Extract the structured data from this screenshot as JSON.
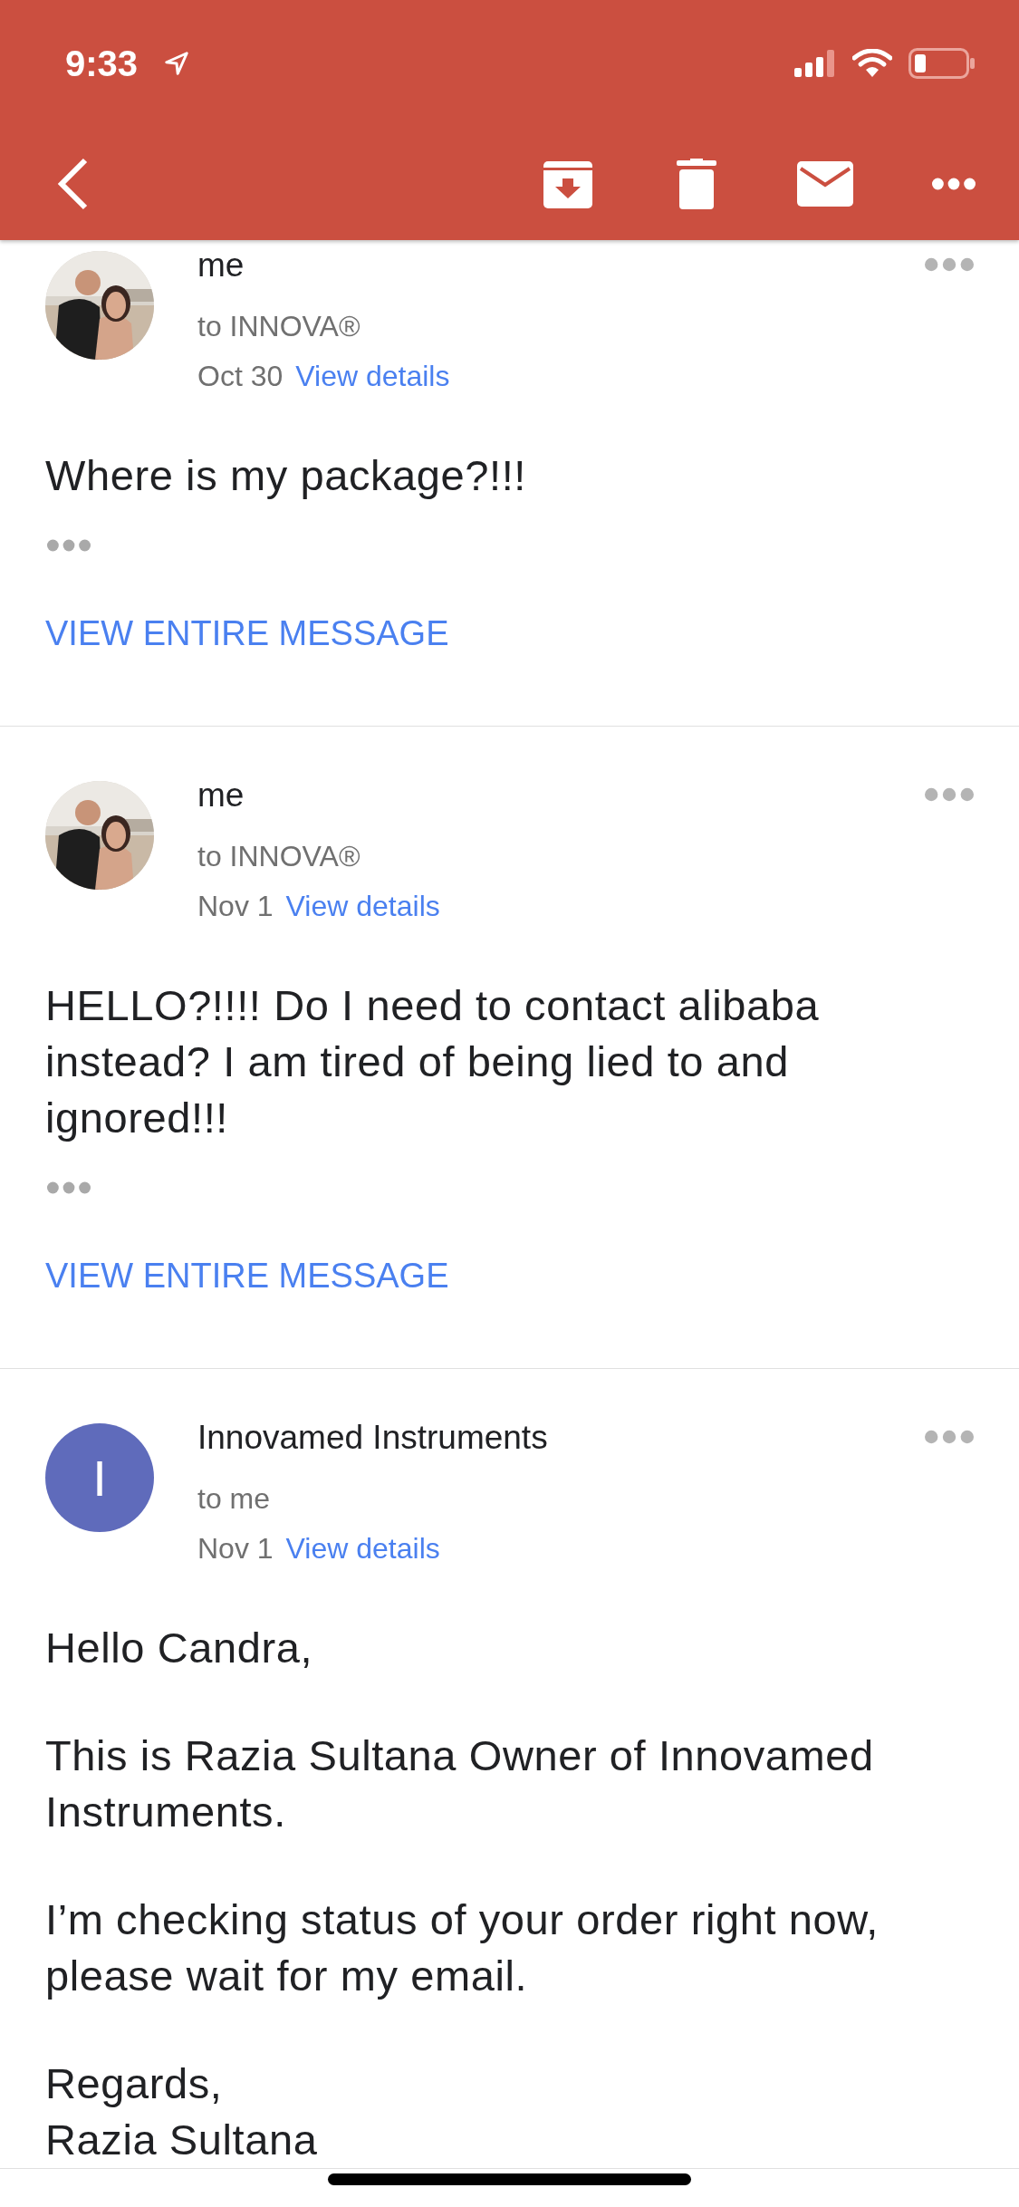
{
  "status_bar": {
    "time": "9:33"
  },
  "messages": [
    {
      "sender": "me",
      "recipient": "to INNOVA®",
      "date": "Oct 30",
      "details_link": "View details",
      "body": [
        "Where is my package?!!!"
      ],
      "trimmed": true,
      "view_entire": "VIEW ENTIRE MESSAGE"
    },
    {
      "sender": "me",
      "recipient": "to INNOVA®",
      "date": "Nov 1",
      "details_link": "View details",
      "body": [
        "HELLO?!!!! Do I need to contact alibaba instead? I am tired of being lied to and ignored!!!"
      ],
      "trimmed": true,
      "view_entire": "VIEW ENTIRE MESSAGE"
    },
    {
      "sender": "Innovamed Instruments",
      "recipient": "to me",
      "date": "Nov 1",
      "details_link": "View details",
      "avatar": {
        "kind": "letter",
        "letter": "I",
        "color": "#5f6bbb"
      },
      "body": [
        "Hello Candra,",
        "This is Razia Sultana Owner of Innovamed Instruments.",
        "I’m checking status of your order right now, please wait for my email.",
        "Regards,\nRazia Sultana"
      ],
      "trimmed": false
    }
  ]
}
